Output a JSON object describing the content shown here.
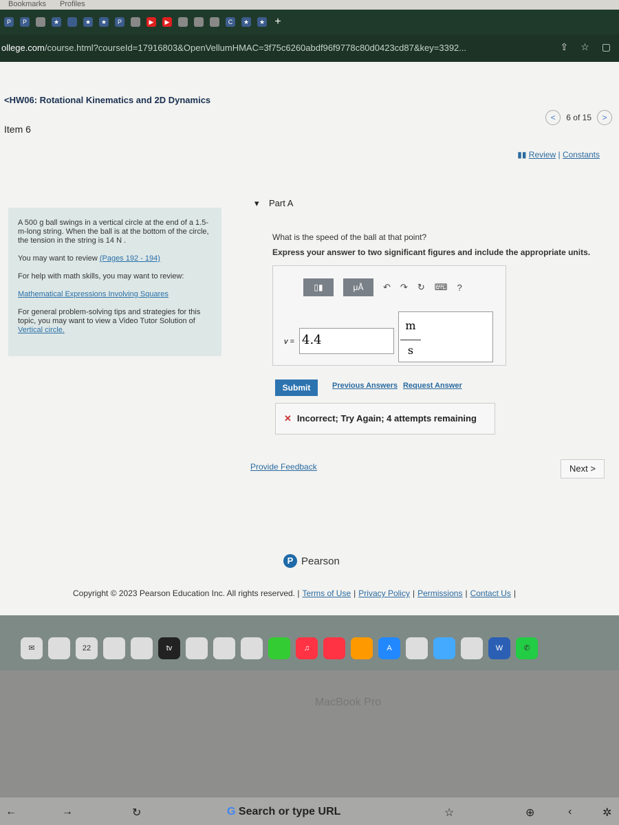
{
  "browser": {
    "menu": [
      "Bookmarks",
      "Profiles"
    ],
    "url_domain": "ollege.com",
    "url_path": "/course.html?courseId=17916803&OpenVellumHMAC=3f75c6260abdf96f9778c80d0423cd87&key=3392..."
  },
  "header": {
    "assignment": "<HW06: Rotational Kinematics and 2D Dynamics",
    "item": "Item 6",
    "pager": "6 of 15",
    "review": "Review",
    "constants": "Constants",
    "sep": "|"
  },
  "problem": {
    "text": "A 500 g ball swings in a vertical circle at the end of a 1.5-m-long string. When the ball is at the bottom of the circle, the tension in the string is 14 N .",
    "review_prefix": "You may want to review ",
    "review_link": "(Pages 192 - 194)",
    "math_help": "For help with math skills, you may want to review:",
    "math_link": "Mathematical Expressions Involving Squares",
    "tips": "For general problem-solving tips and strategies for this topic, you may want to view a Video Tutor Solution of ",
    "tips_link": "Vertical circle."
  },
  "part": {
    "label": "Part A",
    "question": "What is the speed of the ball at that point?",
    "instructions": "Express your answer to two significant figures and include the appropriate units.",
    "var": "v =",
    "value": "4.4",
    "unit_num": "m",
    "unit_den": "s",
    "toolbar_mu": "μÅ",
    "help": "?"
  },
  "actions": {
    "submit": "Submit",
    "previous": "Previous Answers",
    "request": "Request Answer"
  },
  "feedback": {
    "status": "Incorrect; Try Again; 4 attempts remaining",
    "provide": "Provide Feedback",
    "next": "Next >"
  },
  "footer": {
    "brand": "Pearson",
    "copyright": "Copyright © 2023 Pearson Education Inc. All rights reserved. |",
    "links": [
      "Terms of Use",
      "Privacy Policy",
      "Permissions",
      "Contact Us"
    ]
  },
  "dock": {
    "calendar_day": "22",
    "tv": "tv"
  },
  "laptop": {
    "label": "MacBook Pro",
    "touchbar_search": "Search or type URL"
  }
}
